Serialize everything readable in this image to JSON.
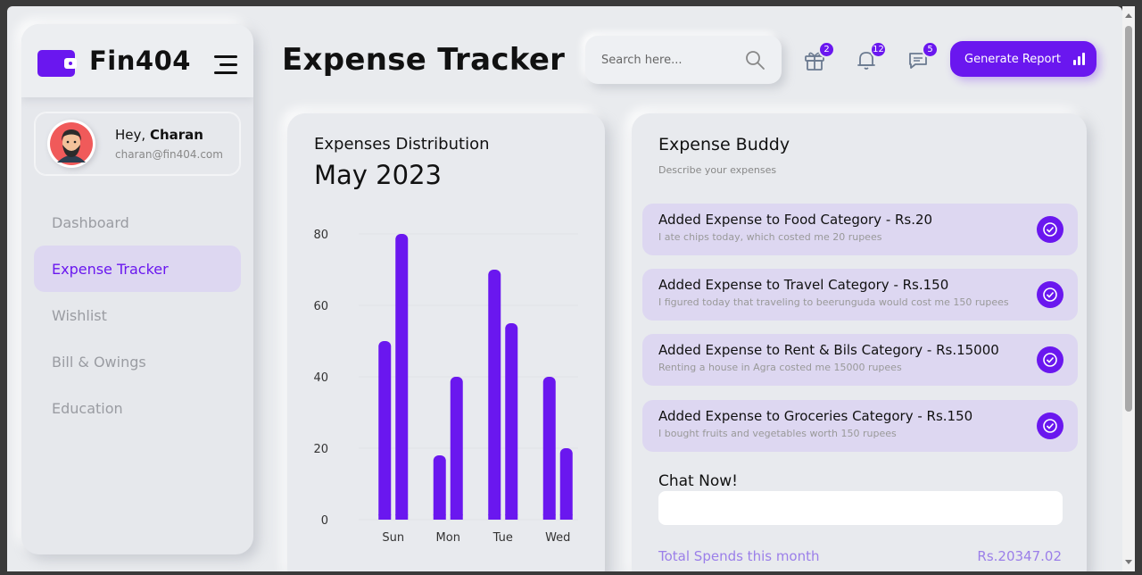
{
  "brand": {
    "name": "Fin404"
  },
  "profile": {
    "greeting": "Hey,",
    "name": "Charan",
    "email": "charan@fin404.com"
  },
  "nav": {
    "items": [
      {
        "label": "Dashboard",
        "active": false
      },
      {
        "label": "Expense Tracker",
        "active": true
      },
      {
        "label": "Wishlist",
        "active": false
      },
      {
        "label": "Bill & Owings",
        "active": false
      },
      {
        "label": "Education",
        "active": false
      }
    ]
  },
  "header": {
    "title": "Expense Tracker",
    "search_placeholder": "Search here...",
    "badges": {
      "gift": "2",
      "bell": "12",
      "messages": "5"
    },
    "generate_report": "Generate Report"
  },
  "chart_card": {
    "title": "Expenses Distribution",
    "month": "May 2023"
  },
  "chart_data": {
    "type": "bar",
    "categories": [
      "Sun",
      "Mon",
      "Tue",
      "Wed"
    ],
    "series": [
      {
        "values": [
          50,
          18,
          70,
          40
        ]
      },
      {
        "values": [
          80,
          40,
          55,
          20
        ]
      }
    ],
    "y_ticks": [
      0,
      20,
      40,
      60,
      80
    ],
    "ylim": [
      0,
      80
    ],
    "color": "#6a17ef"
  },
  "buddy": {
    "title": "Expense Buddy",
    "subtitle": "Describe your expenses",
    "items": [
      {
        "title": "Added Expense to Food Category - Rs.20",
        "desc": "I ate chips today, which costed me 20 rupees"
      },
      {
        "title": "Added Expense to Travel Category - Rs.150",
        "desc": "I figured today that traveling to beerunguda would cost me 150 rupees"
      },
      {
        "title": "Added Expense to Rent & Bils Category - Rs.15000",
        "desc": "Renting a house in Agra costed me 15000 rupees"
      },
      {
        "title": "Added Expense to Groceries Category - Rs.150",
        "desc": "I bought fruits and vegetables worth 150 rupees"
      }
    ],
    "chat_label": "Chat Now!",
    "total_label": "Total Spends this month",
    "total_value": "Rs.20347.02"
  },
  "colors": {
    "accent": "#6a17ef",
    "accent_light": "#ddd7f1",
    "background": "#e9ebee"
  }
}
